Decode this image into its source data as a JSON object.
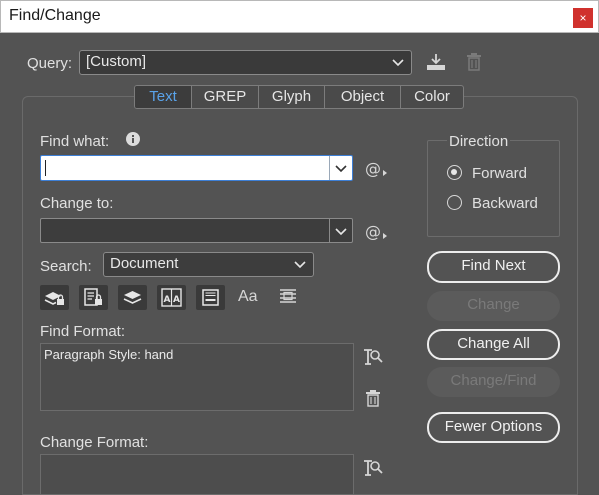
{
  "window": {
    "title": "Find/Change",
    "close_glyph": "×"
  },
  "query": {
    "label": "Query:",
    "value": "[Custom]"
  },
  "tabs": [
    {
      "label": "Text",
      "active": true
    },
    {
      "label": "GREP",
      "active": false
    },
    {
      "label": "Glyph",
      "active": false
    },
    {
      "label": "Object",
      "active": false
    },
    {
      "label": "Color",
      "active": false
    }
  ],
  "find": {
    "label": "Find what:",
    "value": ""
  },
  "change": {
    "label": "Change to:",
    "value": ""
  },
  "search": {
    "label": "Search:",
    "value": "Document"
  },
  "options_text": {
    "case_sensitive": "Aa"
  },
  "find_format": {
    "label": "Find Format:",
    "value": "Paragraph Style: hand"
  },
  "change_format": {
    "label": "Change Format:",
    "value": ""
  },
  "direction": {
    "label": "Direction",
    "forward": "Forward",
    "backward": "Backward",
    "selected": "Forward"
  },
  "buttons": {
    "find_next": "Find Next",
    "change": "Change",
    "change_all": "Change All",
    "change_find": "Change/Find",
    "fewer_options": "Fewer Options"
  },
  "colors": {
    "accent": "#5aa3ea",
    "background": "#535353",
    "close": "#d0312d"
  }
}
